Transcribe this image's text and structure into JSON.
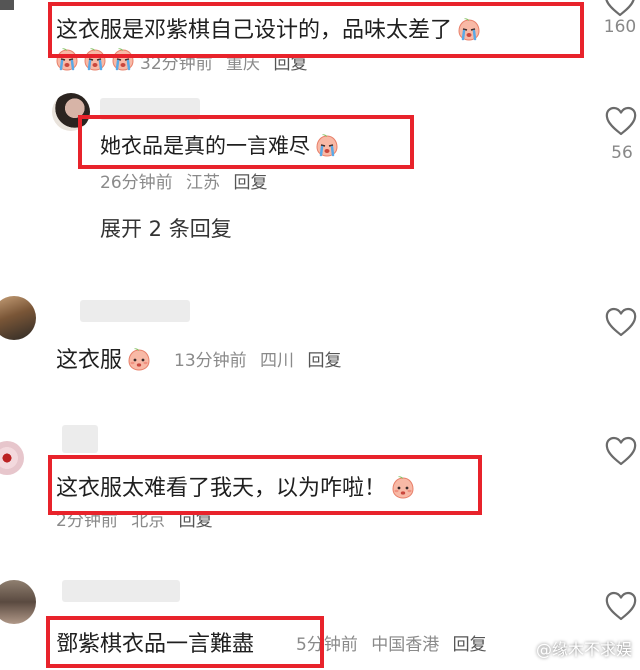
{
  "comments": [
    {
      "text": "这衣服是邓紫棋自己设计的，品味太差了",
      "time": "32分钟前",
      "location": "重庆",
      "reply": "回复",
      "likes": "160"
    },
    {
      "text": "她衣品是真的一言难尽",
      "time": "26分钟前",
      "location": "江苏",
      "reply": "回复",
      "likes": "56",
      "expand": "展开 2 条回复"
    },
    {
      "text": "这衣服",
      "time": "13分钟前",
      "location": "四川",
      "reply": "回复"
    },
    {
      "text": "这衣服太难看了我天，以为咋啦！",
      "time": "2分钟前",
      "location": "北京",
      "reply": "回复"
    },
    {
      "text": "鄧紫棋衣品一言難盡",
      "time": "5分钟前",
      "location": "中国香港",
      "reply": "回复"
    }
  ],
  "watermark": "@缘木不求娱",
  "colors": {
    "highlight": "#e8232b",
    "meta": "#8a8a8a"
  },
  "icons": [
    "heart-outline-icon",
    "crying-emoji-icon",
    "peach-emoji-icon"
  ]
}
